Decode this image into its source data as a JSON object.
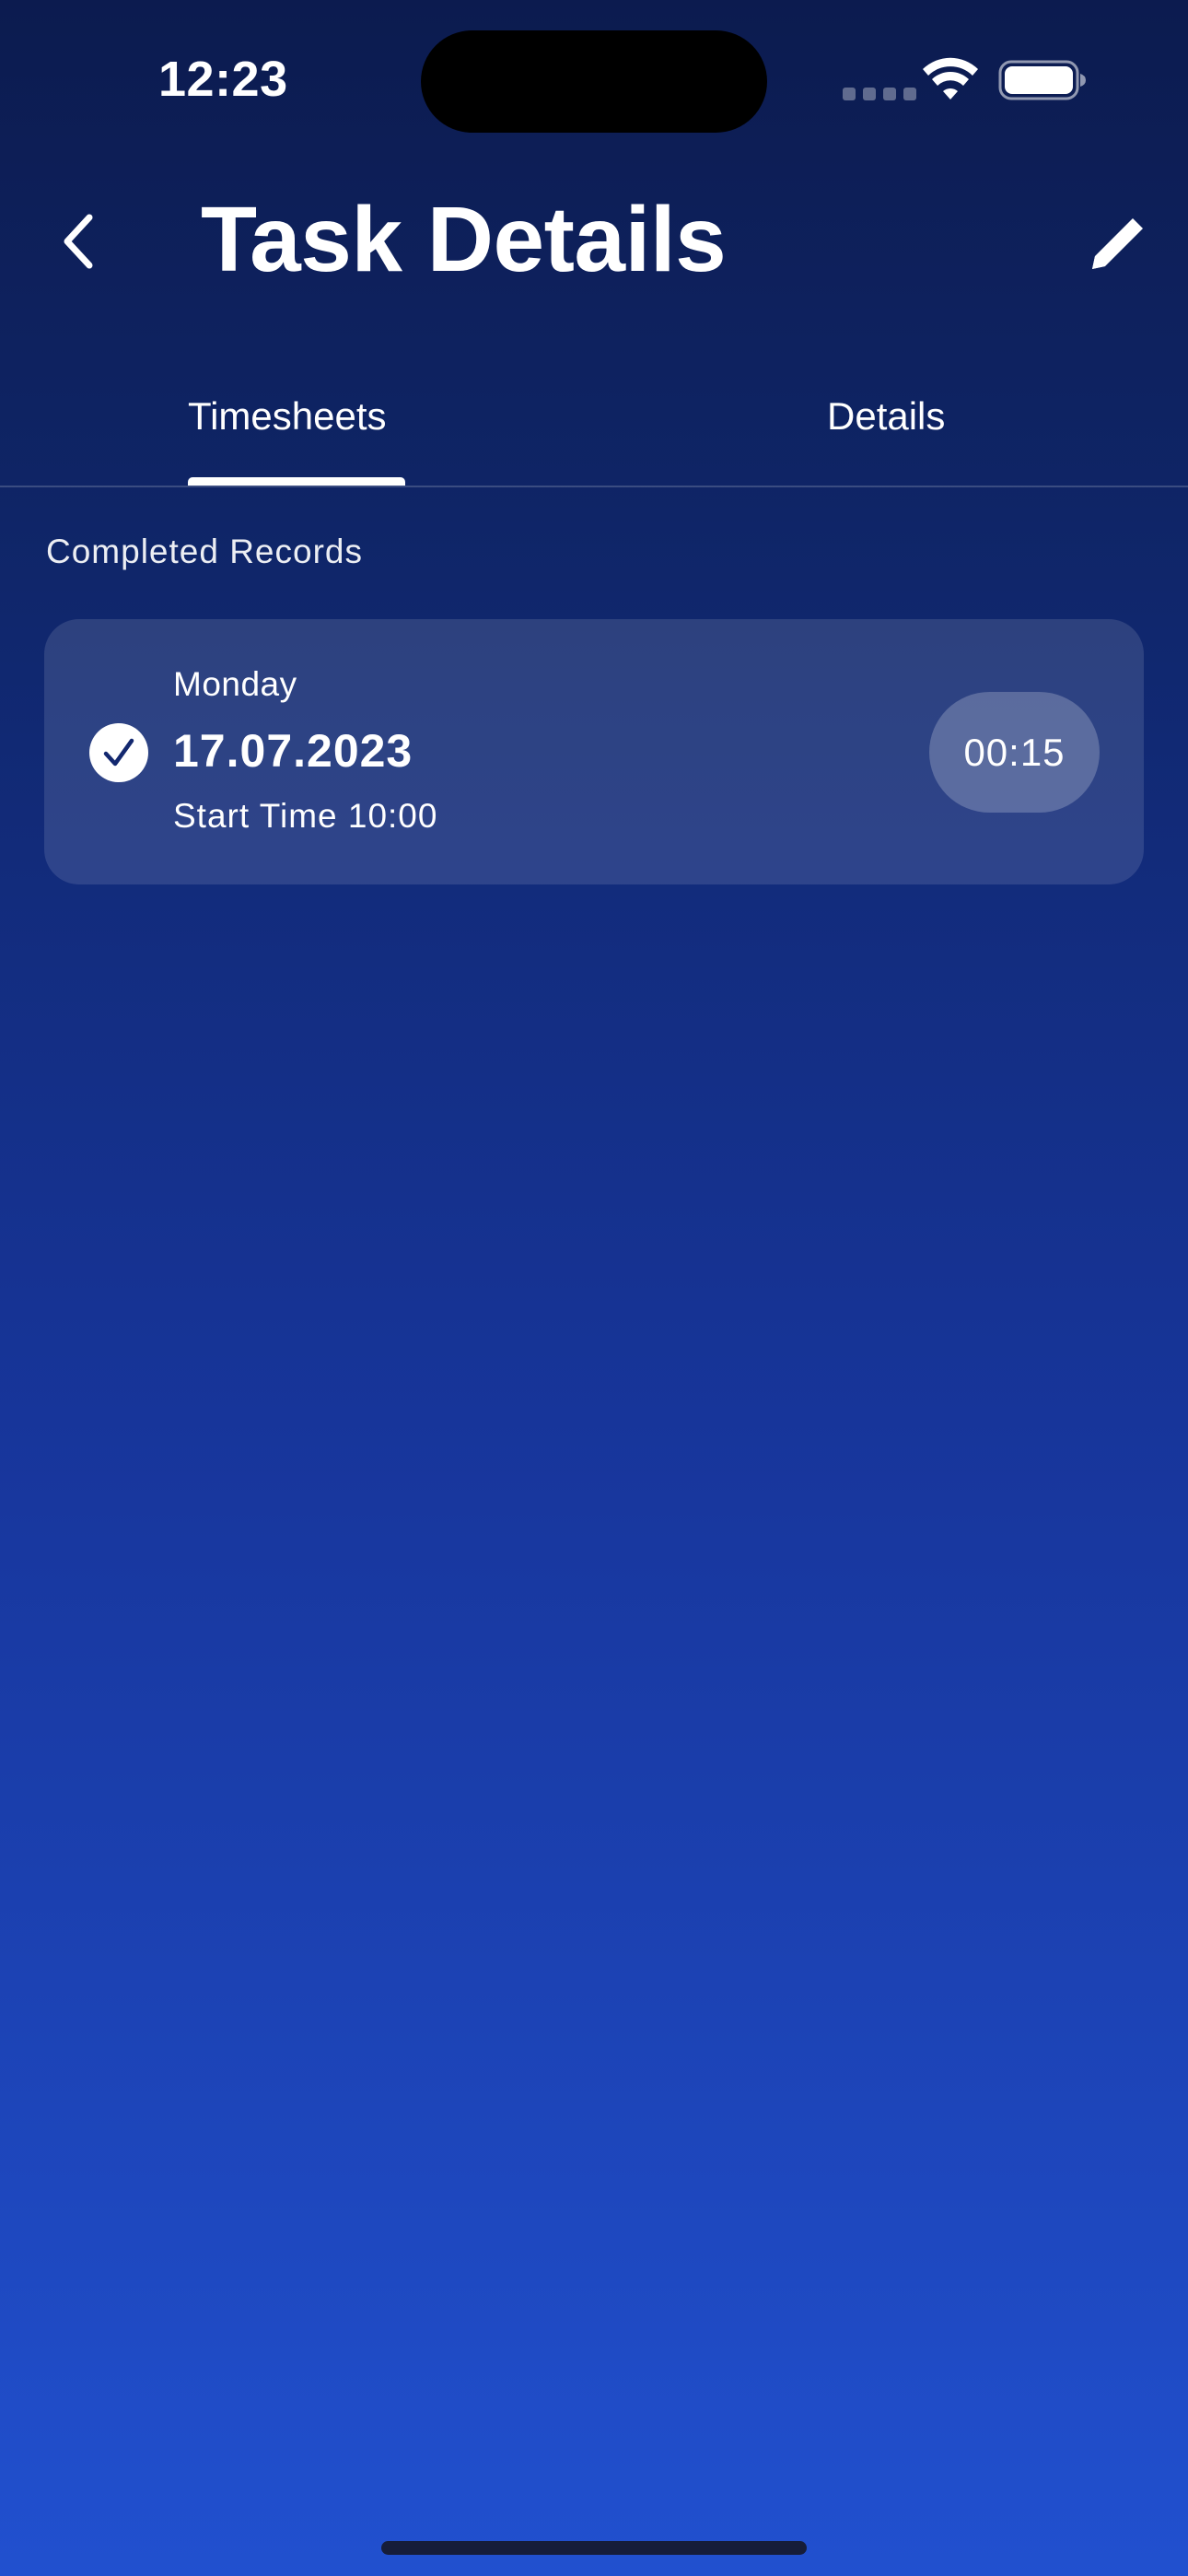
{
  "status_bar": {
    "time": "12:23",
    "icons": [
      "cellular-signal-icon",
      "wifi-icon",
      "battery-icon"
    ]
  },
  "header": {
    "title": "Task Details",
    "back_icon": "chevron-left-icon",
    "edit_icon": "pencil-icon"
  },
  "tabs": [
    {
      "label": "Timesheets",
      "selected": true
    },
    {
      "label": "Details",
      "selected": false
    }
  ],
  "section": {
    "label": "Completed Records"
  },
  "records": [
    {
      "day": "Monday",
      "date": "17.07.2023",
      "start_time": "Start Time 10:00",
      "duration": "00:15",
      "status_icon": "checkmark-circle-icon"
    }
  ],
  "colors": {
    "background_top": "#0c1b4f",
    "background_bottom": "#2150cf",
    "text": "#ffffff"
  }
}
